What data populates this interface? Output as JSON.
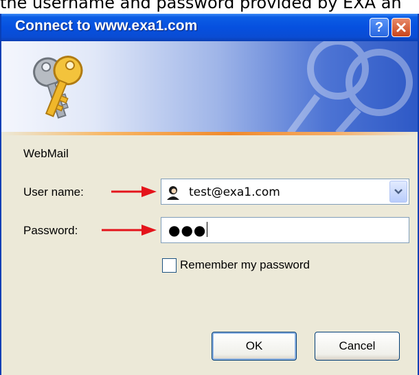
{
  "caption": "the username and password provided by EXA an",
  "dialog": {
    "title": "Connect to www.exa1.com",
    "help_label": "?",
    "realm": "WebMail",
    "username_label": "User name:",
    "username_value": "test@exa1.com",
    "password_label": "Password:",
    "password_masked": "●●●",
    "remember_label": "Remember my password",
    "remember_checked": false,
    "ok_label": "OK",
    "cancel_label": "Cancel"
  },
  "colors": {
    "titlebar": "#0650df",
    "dialog_bg": "#ece9d8",
    "arrow": "#e4141b",
    "close_button": "#c8451b"
  },
  "icons": [
    "keys-icon",
    "help-icon",
    "close-icon",
    "user-avatar-icon",
    "chevron-down-icon",
    "arrow-pointer-icon"
  ]
}
